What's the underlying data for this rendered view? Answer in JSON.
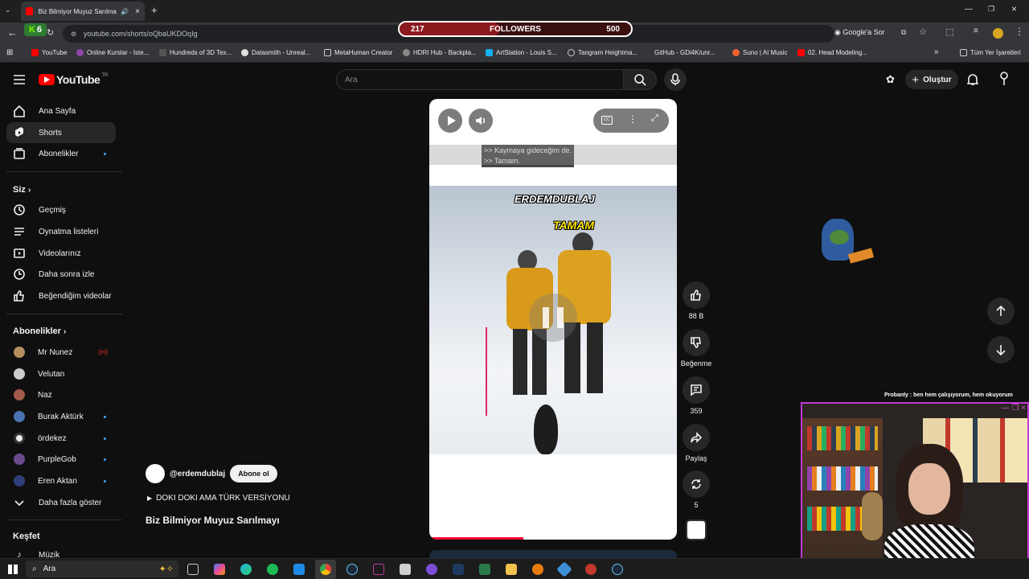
{
  "browser": {
    "tab_title": "Biz Bilmiyor Muyuz Sarılma",
    "url": "youtube.com/shorts/oQbaUKDOqIg",
    "google_ask": "Google'a Sor",
    "bookmarks": [
      "YouTube",
      "Online Kurslar - İste...",
      "Hundreds of 3D Tex...",
      "Datasmith - Unreal...",
      "MetaHuman Creator",
      "HDRI Hub - Backpla...",
      "ArtStation - Louis S...",
      "Tangram Heightma...",
      "GitHub - GDi4K/unr...",
      "Suno | AI Music",
      "02. Head Modeling..."
    ],
    "all_bookmarks": "Tüm Yer İşaretleri",
    "extension_count": "6"
  },
  "overlay": {
    "followers_current": "217",
    "followers_label": "FOLLOWERS",
    "followers_goal": "500",
    "chat_message": "Probanly : ben hem çalışıyorum, hem okuyorum"
  },
  "youtube": {
    "logo": "YouTube",
    "region": "TR",
    "search_placeholder": "Ara",
    "create_label": "Oluştur"
  },
  "sidebar": {
    "main": [
      "Ana Sayfa",
      "Shorts",
      "Abonelikler"
    ],
    "you_title": "Siz",
    "you_items": [
      "Geçmiş",
      "Oynatma listeleri",
      "Videolarınız",
      "Daha sonra izle",
      "Beğendiğim videolar"
    ],
    "subs_title": "Abonelikler",
    "subs": [
      "Mr Nunez",
      "Velutan",
      "Naz",
      "Burak Aktürk",
      "ördekez",
      "PurpleGob",
      "Eren Aktan"
    ],
    "show_more": "Daha fazla göster",
    "explore_title": "Keşfet",
    "explore_items": [
      "Müzik"
    ]
  },
  "short": {
    "caption_line1": ">> Kaymaya gideceğim de.",
    "caption_line2": ">> Tamam.",
    "overlay_text1": "ERDEMDUBLAJ",
    "overlay_text2": "TAMAM",
    "channel": "@erdemdublaj",
    "subscribe": "Abone ol",
    "sound": "DOKI DOKI AMA TÜRK VERSİYONU",
    "title": "Biz Bilmiyor Muyuz Sarılmayı",
    "progress": 0.38
  },
  "actions": {
    "likes": "88 B",
    "dislike": "Beğenme",
    "comments": "359",
    "share": "Paylaş",
    "remix": "5"
  },
  "taskbar": {
    "search": "Ara"
  },
  "colors": {
    "yt_red": "#ff0000",
    "accent_blue": "#3ea6ff",
    "cam_border": "#c43bd6"
  }
}
